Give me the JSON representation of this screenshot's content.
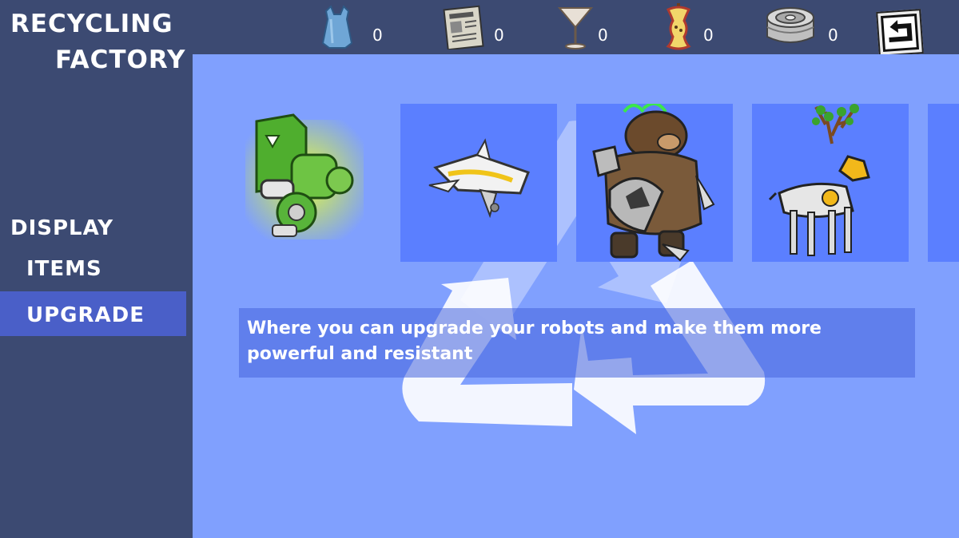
{
  "app": {
    "title_line1": "RECYCLING",
    "title_line2": "FACTORY"
  },
  "menu": {
    "display_label": "DISPLAY",
    "items_label": "ITEMS",
    "upgrade_label": "UPGRADE",
    "selected": "UPGRADE"
  },
  "resources": [
    {
      "name": "plastic-bag",
      "icon": "plastic-bag-icon",
      "count": "0"
    },
    {
      "name": "newspaper",
      "icon": "newspaper-icon",
      "count": "0"
    },
    {
      "name": "glass",
      "icon": "martini-glass-icon",
      "count": "0"
    },
    {
      "name": "apple-core",
      "icon": "apple-core-icon",
      "count": "0"
    },
    {
      "name": "metal-can",
      "icon": "tin-can-icon",
      "count": "0"
    }
  ],
  "robots": [
    {
      "name": "green-mech-robot",
      "selected": true
    },
    {
      "name": "jet-plane-robot",
      "selected": false
    },
    {
      "name": "bear-robot",
      "selected": false
    },
    {
      "name": "deer-robot",
      "selected": false
    }
  ],
  "description": "Where you can upgrade your robots and make them more powerful and resistant",
  "colors": {
    "sidebar": "#3c4a72",
    "content": "#80a0fe",
    "card": "#5b7fff",
    "highlight": "#4a5fc8"
  }
}
